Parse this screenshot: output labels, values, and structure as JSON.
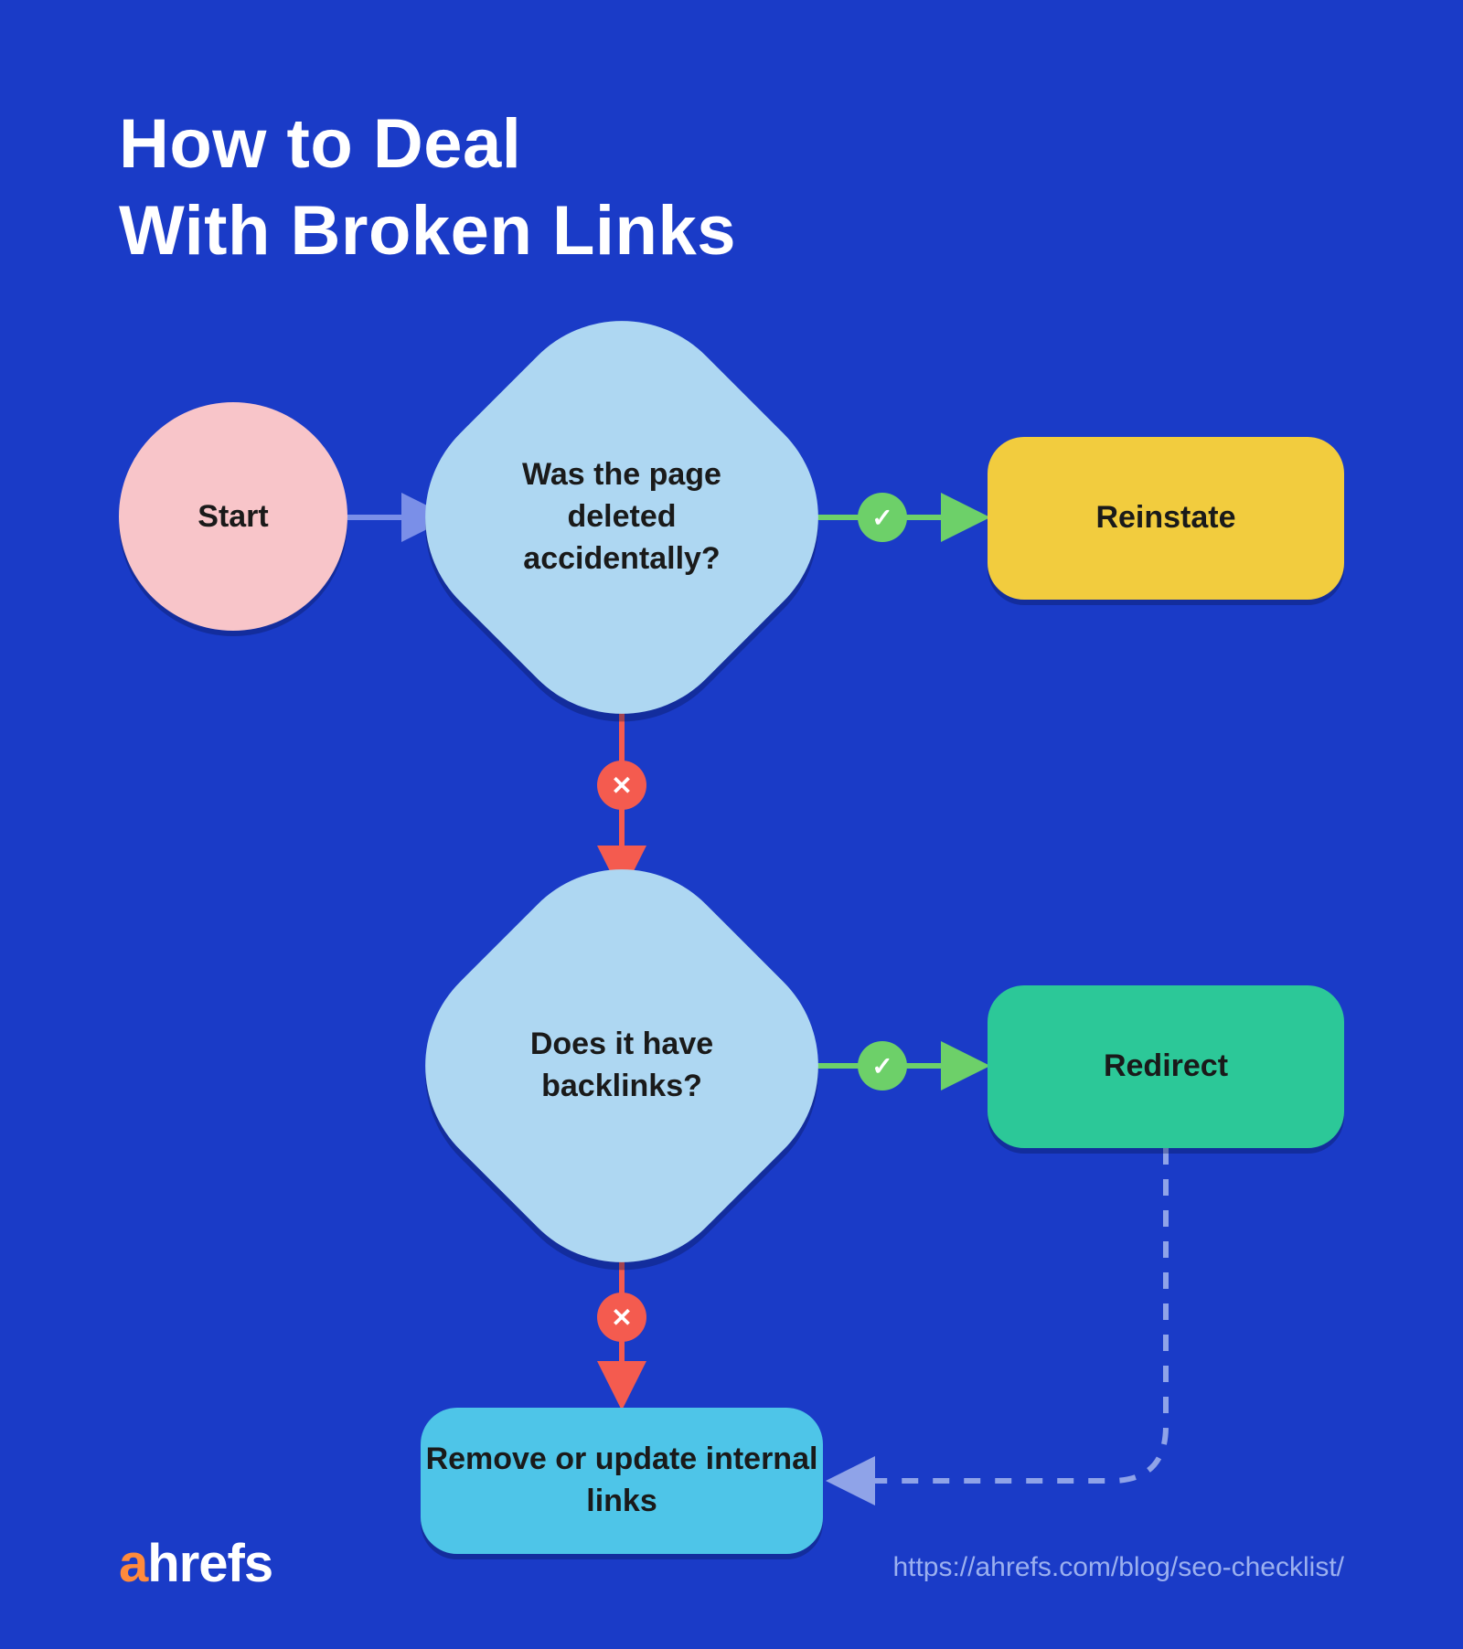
{
  "title_line1": "How to Deal",
  "title_line2": "With Broken Links",
  "nodes": {
    "start": "Start",
    "decision1": "Was the page deleted accidentally?",
    "decision2": "Does it have backlinks?",
    "reinstate": "Reinstate",
    "redirect": "Redirect",
    "remove": "Remove or update internal links"
  },
  "badges": {
    "yes": "✓",
    "no": "✕"
  },
  "footer": {
    "logo_prefix_letter": "a",
    "logo_rest": "hrefs",
    "url": "https://ahrefs.com/blog/seo-checklist/"
  },
  "colors": {
    "background": "#1a3bc7",
    "start": "#f8c5c9",
    "decision": "#aed7f2",
    "reinstate": "#f2cc3e",
    "redirect": "#2cc898",
    "remove": "#4ec5e8",
    "yes_badge": "#6dd069",
    "no_badge": "#f45b4f",
    "arrow_blue": "#7a8fe8",
    "arrow_green": "#6dd069",
    "arrow_red": "#f45b4f",
    "arrow_dashed": "#8fa3e8"
  }
}
